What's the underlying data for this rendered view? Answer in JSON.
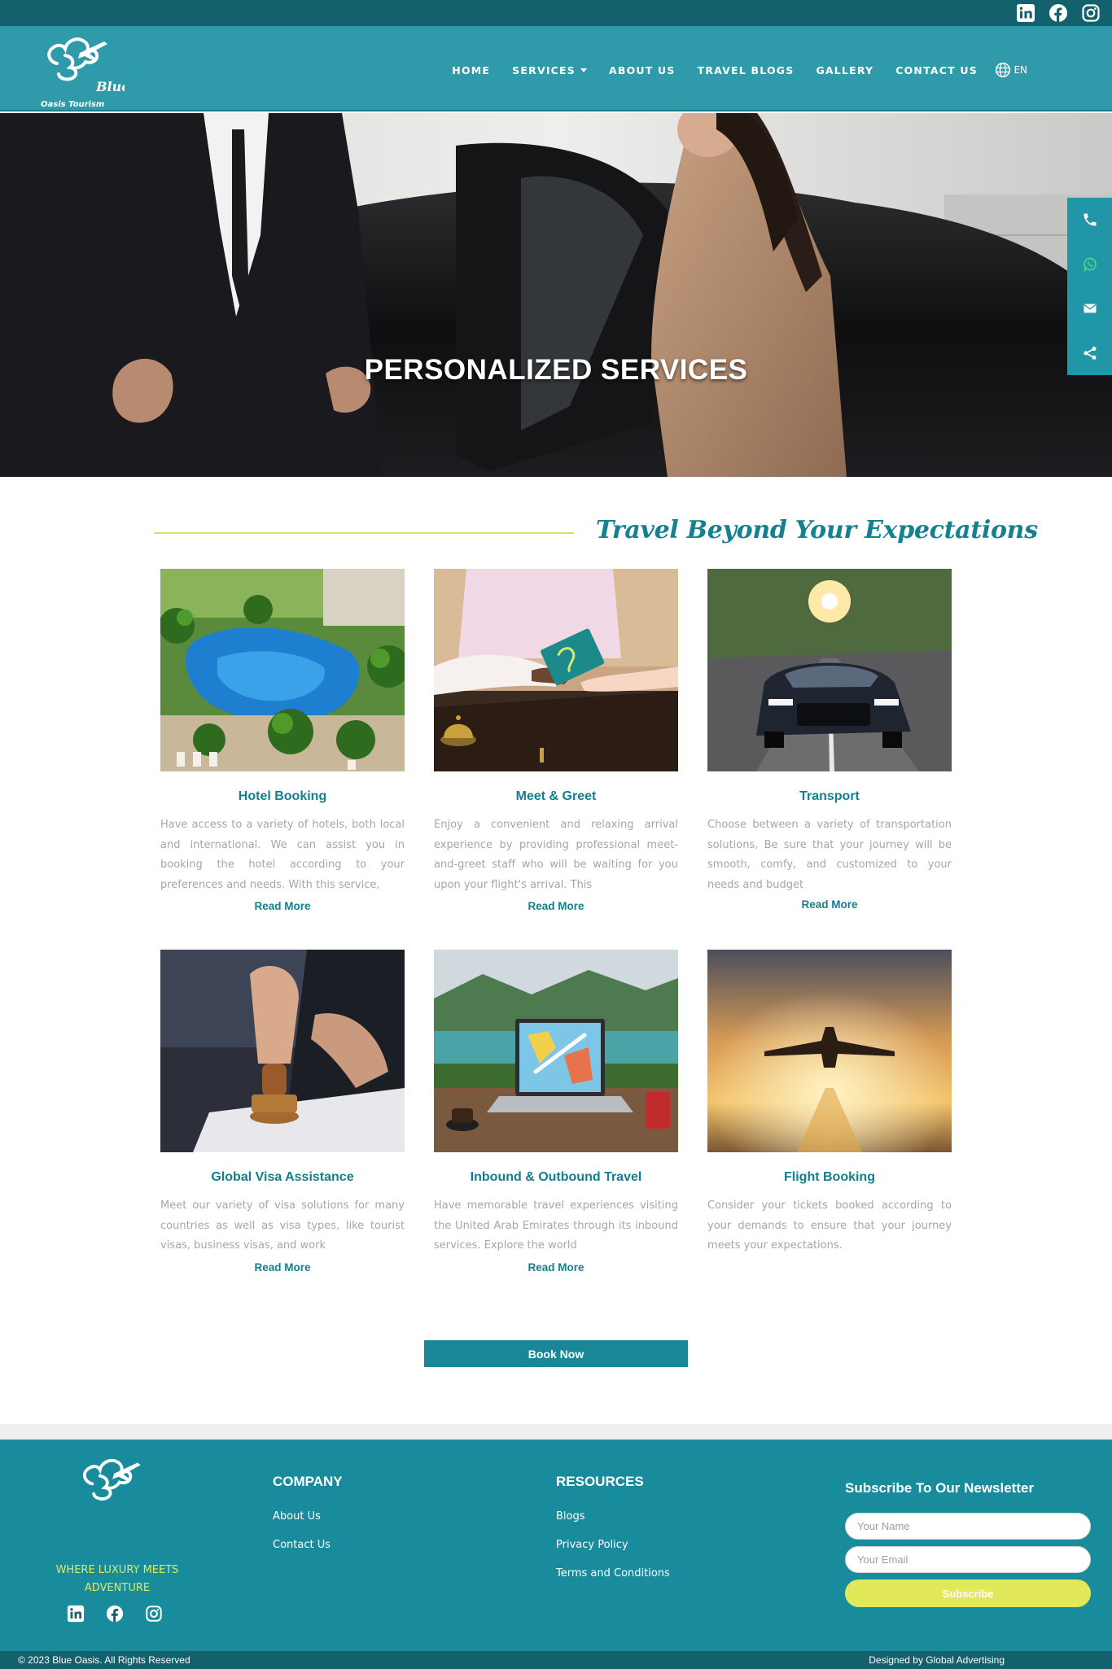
{
  "brand": {
    "name_line1": "Blue",
    "name_line2": "Oasis Tourism"
  },
  "nav": {
    "items": [
      {
        "label": "HOME"
      },
      {
        "label": "SERVICES"
      },
      {
        "label": "ABOUT US"
      },
      {
        "label": "TRAVEL BLOGS"
      },
      {
        "label": "GALLERY"
      },
      {
        "label": "CONTACT US"
      }
    ],
    "language": "EN"
  },
  "social": [
    "linkedin-icon",
    "facebook-icon",
    "instagram-icon"
  ],
  "hero": {
    "title": "PERSONALIZED SERVICES"
  },
  "dock": [
    "phone-icon",
    "whatsapp-icon",
    "email-icon",
    "share-icon"
  ],
  "section": {
    "title": "Travel Beyond Your Expectations"
  },
  "services": [
    {
      "title": "Hotel Booking",
      "description": "Have access to a variety of hotels, both local and international. We can assist you in booking the hotel according to your preferences and needs. With this service,",
      "more": "Read More"
    },
    {
      "title": "Meet & Greet",
      "description": "Enjoy a convenient and relaxing arrival experience by providing professional meet-and-greet staff who will be waiting for you upon your flight's arrival. This",
      "more": "Read More"
    },
    {
      "title": "Transport",
      "description": "Choose between a variety of transportation solutions, Be sure that your journey will be smooth, comfy, and customized to your needs and budget",
      "more": "Read More"
    },
    {
      "title": "Global Visa Assistance",
      "description": "Meet our variety of visa solutions for many countries as well as visa types, like tourist visas, business visas, and work",
      "more": "Read More"
    },
    {
      "title": "Inbound & Outbound Travel",
      "description": "Have memorable travel experiences visiting the United Arab Emirates through its inbound services. Explore the world",
      "more": "Read More"
    },
    {
      "title": "Flight Booking",
      "description": "Consider your tickets booked according to your demands to ensure that your journey meets your expectations.",
      "more": ""
    }
  ],
  "book_now": "Book Now",
  "footer": {
    "tagline": "WHERE LUXURY MEETS ADVENTURE",
    "company": {
      "heading": "COMPANY",
      "links": [
        "About Us",
        "Contact Us"
      ]
    },
    "resources": {
      "heading": "RESOURCES",
      "links": [
        "Blogs",
        "Privacy Policy",
        "Terms and Conditions"
      ]
    },
    "newsletter": {
      "heading": "Subscribe To Our Newsletter",
      "name_placeholder": "Your Name",
      "email_placeholder": "Your Email",
      "button": "Subscribe"
    },
    "copyright": "© 2023 Blue Oasis. All Rights Reserved",
    "credit": "Designed by Global Advertising"
  },
  "colors": {
    "header": "#2f9aaa",
    "topbar": "#13616d",
    "accent": "#15808f",
    "footer": "#188c9c",
    "highlight": "#e1e85a"
  }
}
